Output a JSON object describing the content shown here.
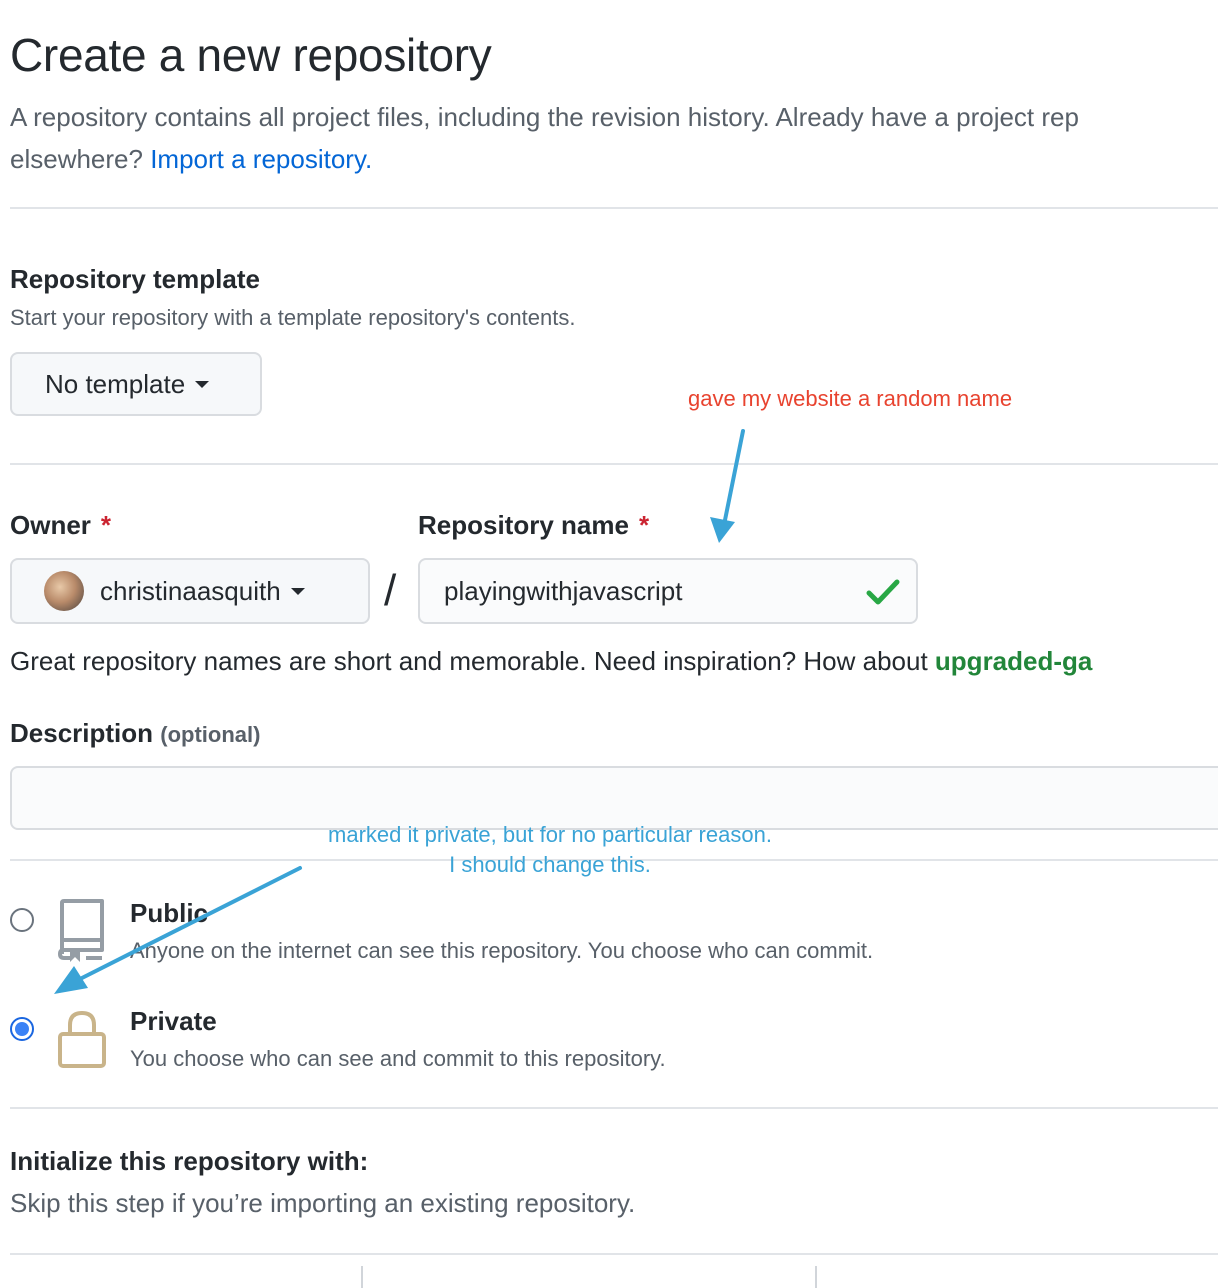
{
  "header": {
    "title": "Create a new repository",
    "intro_line1": "A repository contains all project files, including the revision history. Already have a project rep",
    "intro_line2_prefix": "elsewhere? ",
    "import_link": "Import a repository."
  },
  "template": {
    "heading": "Repository template",
    "subtext": "Start your repository with a template repository's contents.",
    "button_label": "No template"
  },
  "owner": {
    "label": "Owner",
    "required_mark": "*",
    "value": "christinaasquith"
  },
  "separator": "/",
  "repo_name": {
    "label": "Repository name",
    "required_mark": "*",
    "value": "playingwithjavascript"
  },
  "name_hint": {
    "text": "Great repository names are short and memorable. Need inspiration? How about ",
    "suggestion": "upgraded-ga"
  },
  "description": {
    "label": "Description",
    "optional": "(optional)",
    "value": ""
  },
  "visibility": {
    "public": {
      "title": "Public",
      "desc": "Anyone on the internet can see this repository. You choose who can commit.",
      "checked": false
    },
    "private": {
      "title": "Private",
      "desc": "You choose who can see and commit to this repository.",
      "checked": true
    }
  },
  "initialize": {
    "heading": "Initialize this repository with:",
    "subtext": "Skip this step if you’re importing an existing repository."
  },
  "annotations": {
    "name_note": "gave my website a random name",
    "private_note_line1": "marked it private, but for no particular reason.",
    "private_note_line2": "I should change this."
  },
  "colors": {
    "link": "#0366d6",
    "required": "#cb2431",
    "success": "#28a745",
    "suggestion": "#22863a",
    "annotation_red": "#e8432f",
    "annotation_blue": "#3aa3d6",
    "radio_selected": "#3b82f6"
  },
  "icons": {
    "template_caret": "chevron-down-icon",
    "owner_caret": "chevron-down-icon",
    "valid": "check-icon",
    "public": "repo-icon",
    "private": "lock-icon"
  }
}
